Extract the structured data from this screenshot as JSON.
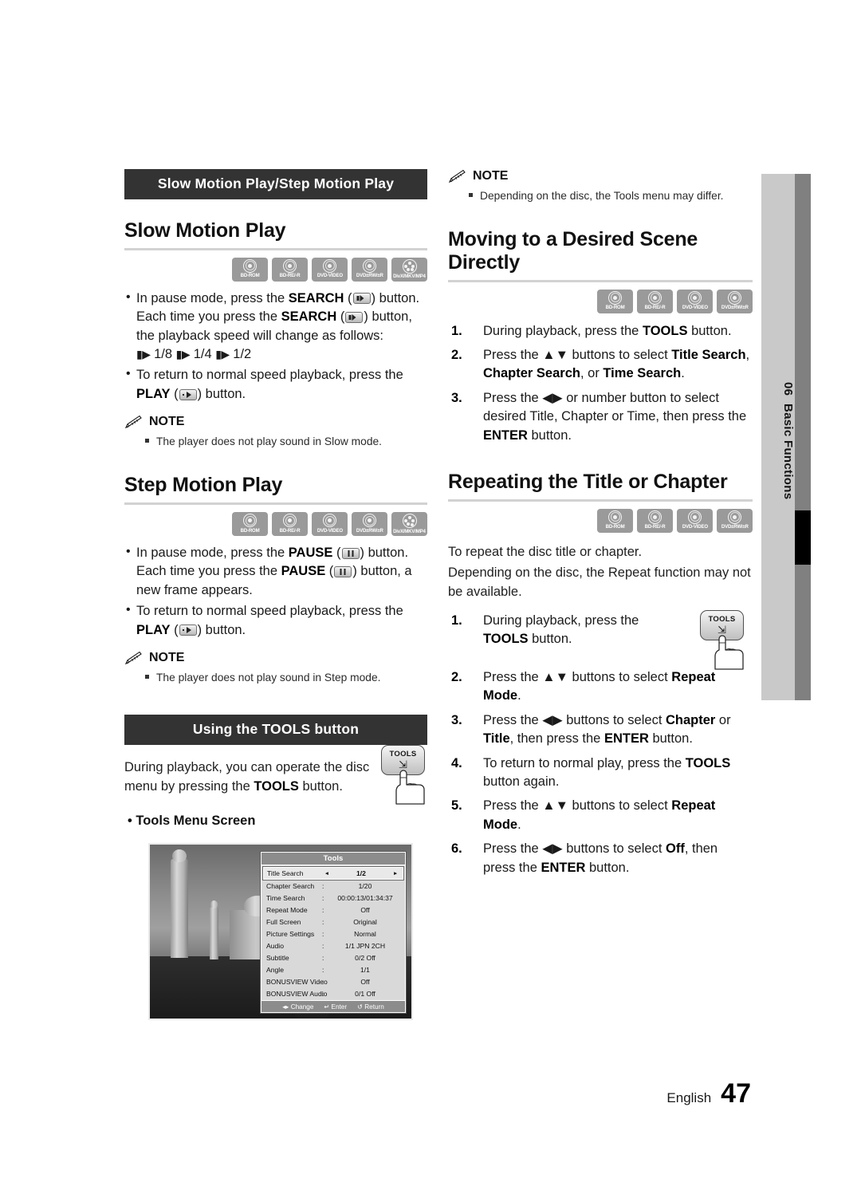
{
  "side_tab": {
    "chapter_number": "06",
    "chapter_title": "Basic Functions"
  },
  "footer": {
    "language": "English",
    "page_number": "47"
  },
  "left_column": {
    "band_title": "Slow Motion Play/Step Motion Play",
    "slow": {
      "heading": "Slow Motion Play",
      "badges": [
        "BD-ROM",
        "BD-RE/-R",
        "DVD-VIDEO",
        "DVD±RW/±R",
        "DivX/MKV/MP4"
      ],
      "bullet1_a": "In pause mode, press the ",
      "bullet1_bold": "SEARCH",
      "bullet1_b": ") button.",
      "bullet1_line2_a": "Each time you press the ",
      "bullet1_line2_bold": "SEARCH",
      "bullet1_line2_b": ") button, the playback speed will change as follows:",
      "speed_sequence": "1/8      1/4      1/2",
      "bullet2_a": "To return to normal speed playback, press the ",
      "bullet2_bold": "PLAY",
      "bullet2_b": ") button.",
      "note_label": "NOTE",
      "note_items": [
        "The player does not play sound in Slow mode."
      ]
    },
    "step": {
      "heading": "Step Motion Play",
      "badges": [
        "BD-ROM",
        "BD-RE/-R",
        "DVD-VIDEO",
        "DVD±RW/±R",
        "DivX/MKV/MP4"
      ],
      "bullet1_a": "In pause mode, press the ",
      "bullet1_bold": "PAUSE",
      "bullet1_b": ") button.",
      "bullet1_line2_a": "Each time you press the ",
      "bullet1_line2_bold": "PAUSE",
      "bullet1_line2_b": ") button, a new frame appears.",
      "bullet2_a": "To return to normal speed playback, press the ",
      "bullet2_bold": "PLAY",
      "bullet2_b": ") button.",
      "note_label": "NOTE",
      "note_items": [
        "The player does not play sound in Step mode."
      ]
    },
    "tools_band": {
      "band_title": "Using the TOOLS button",
      "intro_a": "During playback, you can operate the disc menu by pressing the ",
      "intro_bold": "TOOLS",
      "intro_b": " button.",
      "tools_key_label": "TOOLS",
      "screen_caption": "Tools Menu Screen"
    }
  },
  "right_column": {
    "top_note": {
      "note_label": "NOTE",
      "note_items": [
        "Depending on the disc, the Tools menu may differ."
      ]
    },
    "moving": {
      "heading": "Moving to a Desired Scene Directly",
      "badges": [
        "BD-ROM",
        "BD-RE/-R",
        "DVD-VIDEO",
        "DVD±RW/±R"
      ],
      "steps": [
        {
          "num": "1.",
          "a": "During playback, press the ",
          "b1": "TOOLS",
          "c": " button."
        },
        {
          "num": "2.",
          "a": "Press the ▲▼ buttons to select ",
          "b1": "Title Search",
          "c": ", ",
          "b2": "Chapter Search",
          "d": ", or ",
          "b3": "Time Search",
          "e": "."
        },
        {
          "num": "3.",
          "a": "Press the ◀▶ or number button to select desired Title, Chapter or Time, then press the ",
          "b1": "ENTER",
          "c": " button."
        }
      ]
    },
    "repeating": {
      "heading": "Repeating the Title or Chapter",
      "badges": [
        "BD-ROM",
        "BD-RE/-R",
        "DVD-VIDEO",
        "DVD±RW/±R"
      ],
      "intro_line1": "To repeat the disc title or chapter.",
      "intro_line2": "Depending on the disc, the Repeat function may not be available.",
      "tools_key_label": "TOOLS",
      "steps": [
        {
          "num": "1.",
          "a": "During playback, press the ",
          "b1": "TOOLS",
          "c": " button."
        },
        {
          "num": "2.",
          "a": "Press the ▲▼ buttons to select ",
          "b1": "Repeat Mode",
          "c": "."
        },
        {
          "num": "3.",
          "a": "Press the ◀▶ buttons to select ",
          "b1": "Chapter",
          "c": " or ",
          "b2": "Title",
          "d": ", then press the ",
          "b3": "ENTER",
          "e": " button."
        },
        {
          "num": "4.",
          "a": "To return to normal play, press the ",
          "b1": "TOOLS",
          "c": " button again."
        },
        {
          "num": "5.",
          "a": "Press the ▲▼ buttons to select ",
          "b1": "Repeat Mode",
          "c": "."
        },
        {
          "num": "6.",
          "a": "Press the ◀▶ buttons to select ",
          "b1": "Off",
          "c": ", then press the ",
          "b2": "ENTER",
          "d": " button."
        }
      ]
    }
  },
  "tools_screen": {
    "title": "Tools",
    "rows": [
      {
        "label": "Title Search",
        "value": "1/2",
        "selected": true,
        "sep": ""
      },
      {
        "label": "Chapter Search",
        "value": "1/20",
        "selected": false,
        "sep": ":"
      },
      {
        "label": "Time Search",
        "value": "00:00:13/01:34:37",
        "selected": false,
        "sep": ":"
      },
      {
        "label": "Repeat Mode",
        "value": "Off",
        "selected": false,
        "sep": ":"
      },
      {
        "label": "Full Screen",
        "value": "Original",
        "selected": false,
        "sep": ":"
      },
      {
        "label": "Picture Settings",
        "value": "Normal",
        "selected": false,
        "sep": ":"
      },
      {
        "label": "Audio",
        "value": "1/1 JPN 2CH",
        "selected": false,
        "sep": ":"
      },
      {
        "label": "Subtitle",
        "value": "0/2 Off",
        "selected": false,
        "sep": ":"
      },
      {
        "label": "Angle",
        "value": "1/1",
        "selected": false,
        "sep": ":"
      },
      {
        "label": "BONUSVIEW Video",
        "value": "Off",
        "selected": false,
        "sep": ":"
      },
      {
        "label": "BONUSVIEW Audio",
        "value": "0/1 Off",
        "selected": false,
        "sep": ":"
      }
    ],
    "footer": {
      "change": "Change",
      "enter": "Enter",
      "return": "Return"
    }
  },
  "colors": {
    "band_bg": "#333333",
    "tab_light": "#c9c9c9",
    "tab_dark": "#808080",
    "rule": "#d2d2d2",
    "badge_bg": "#9a9a9a"
  }
}
